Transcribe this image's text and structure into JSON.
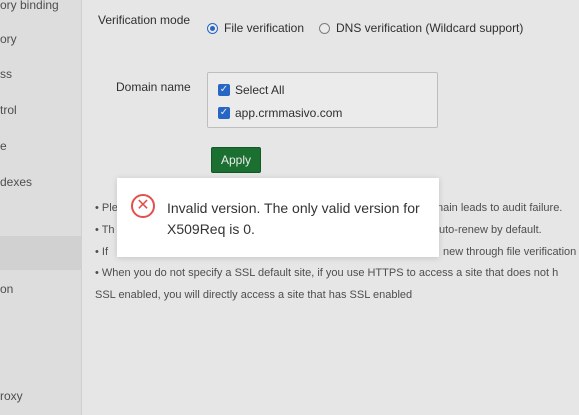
{
  "sidebar": {
    "items": [
      {
        "label": "ory binding"
      },
      {
        "label": "ory"
      },
      {
        "label": "ss"
      },
      {
        "label": "trol"
      },
      {
        "label": "e"
      },
      {
        "label": "dexes"
      },
      {
        "label": ""
      },
      {
        "label": ""
      },
      {
        "label": "on"
      },
      {
        "label": "roxy"
      }
    ]
  },
  "form": {
    "verification_mode_label": "Verification mode",
    "option_file": "File verification",
    "option_dns": "DNS verification (Wildcard support)",
    "selected_option": "File verification",
    "domain_name_label": "Domain name",
    "domains": [
      {
        "label": "Select All",
        "checked": true
      },
      {
        "label": "app.crmmasivo.com",
        "checked": true
      }
    ],
    "apply_label": "Apply",
    "apply_color": "#1e7a36"
  },
  "tips": {
    "line1_left": "• Ple",
    "line1_right": "nain leads to audit failure.",
    "line2_left": "• Th",
    "line2_right": "uto-renew by default.",
    "line3_left": "• If",
    "line3_right": "new through file verification",
    "line4": "• When you do not specify a SSL default site, if you use HTTPS to access a site that does not h",
    "line5": "SSL enabled, you will directly access a site that has SSL enabled"
  },
  "toast": {
    "icon": "error-circle-x-icon",
    "message": "Invalid version. The only valid version for X509Req is 0.",
    "icon_color": "#e2504c"
  }
}
